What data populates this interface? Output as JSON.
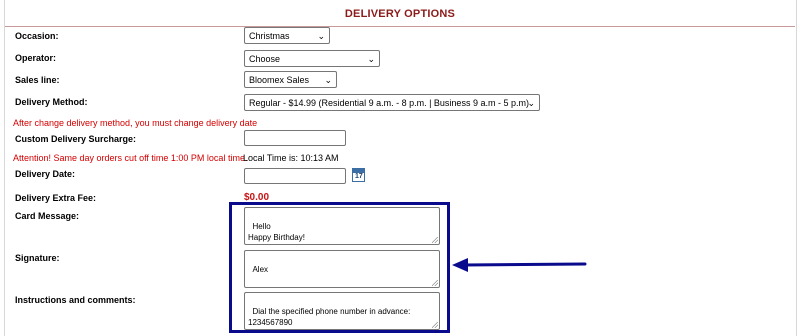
{
  "section_title": "DELIVERY OPTIONS",
  "occasion": {
    "label": "Occasion:",
    "value": "Christmas"
  },
  "operator": {
    "label": "Operator:",
    "value": "Choose"
  },
  "sales_line": {
    "label": "Sales line:",
    "value": "Bloomex Sales"
  },
  "delivery_method": {
    "label": "Delivery Method:",
    "value": "Regular - $14.99 (Residential 9 a.m. - 8 p.m. | Business 9 a.m - 5 p.m)"
  },
  "delivery_method_warning": "After change delivery method, you must change delivery date",
  "custom_surcharge": {
    "label": "Custom Delivery Surcharge:",
    "value": ""
  },
  "same_day_warning": "Attention! Same day orders cut off time 1:00 PM local time.",
  "local_time": "Local Time is: 10:13 AM",
  "delivery_date": {
    "label": "Delivery Date:",
    "value": "",
    "calendar_day": "17",
    "icon": "calendar-icon"
  },
  "extra_fee": {
    "label": "Delivery Extra Fee:",
    "value": "$0.00"
  },
  "card_message": {
    "label": "Card Message:",
    "value": "Hello\nHappy Birthday!"
  },
  "signature": {
    "label": "Signature:",
    "value": "Alex"
  },
  "instructions": {
    "label": "Instructions and comments:",
    "value": "Dial the specified phone number in advance:\n1234567890"
  },
  "colors": {
    "title": "#8b1a1a",
    "warning": "#d40000",
    "fee": "#c81414",
    "highlight": "#0a0a8c"
  },
  "annotation": {
    "highlight_box": "highlight-box",
    "arrow": "left-arrow-icon"
  }
}
